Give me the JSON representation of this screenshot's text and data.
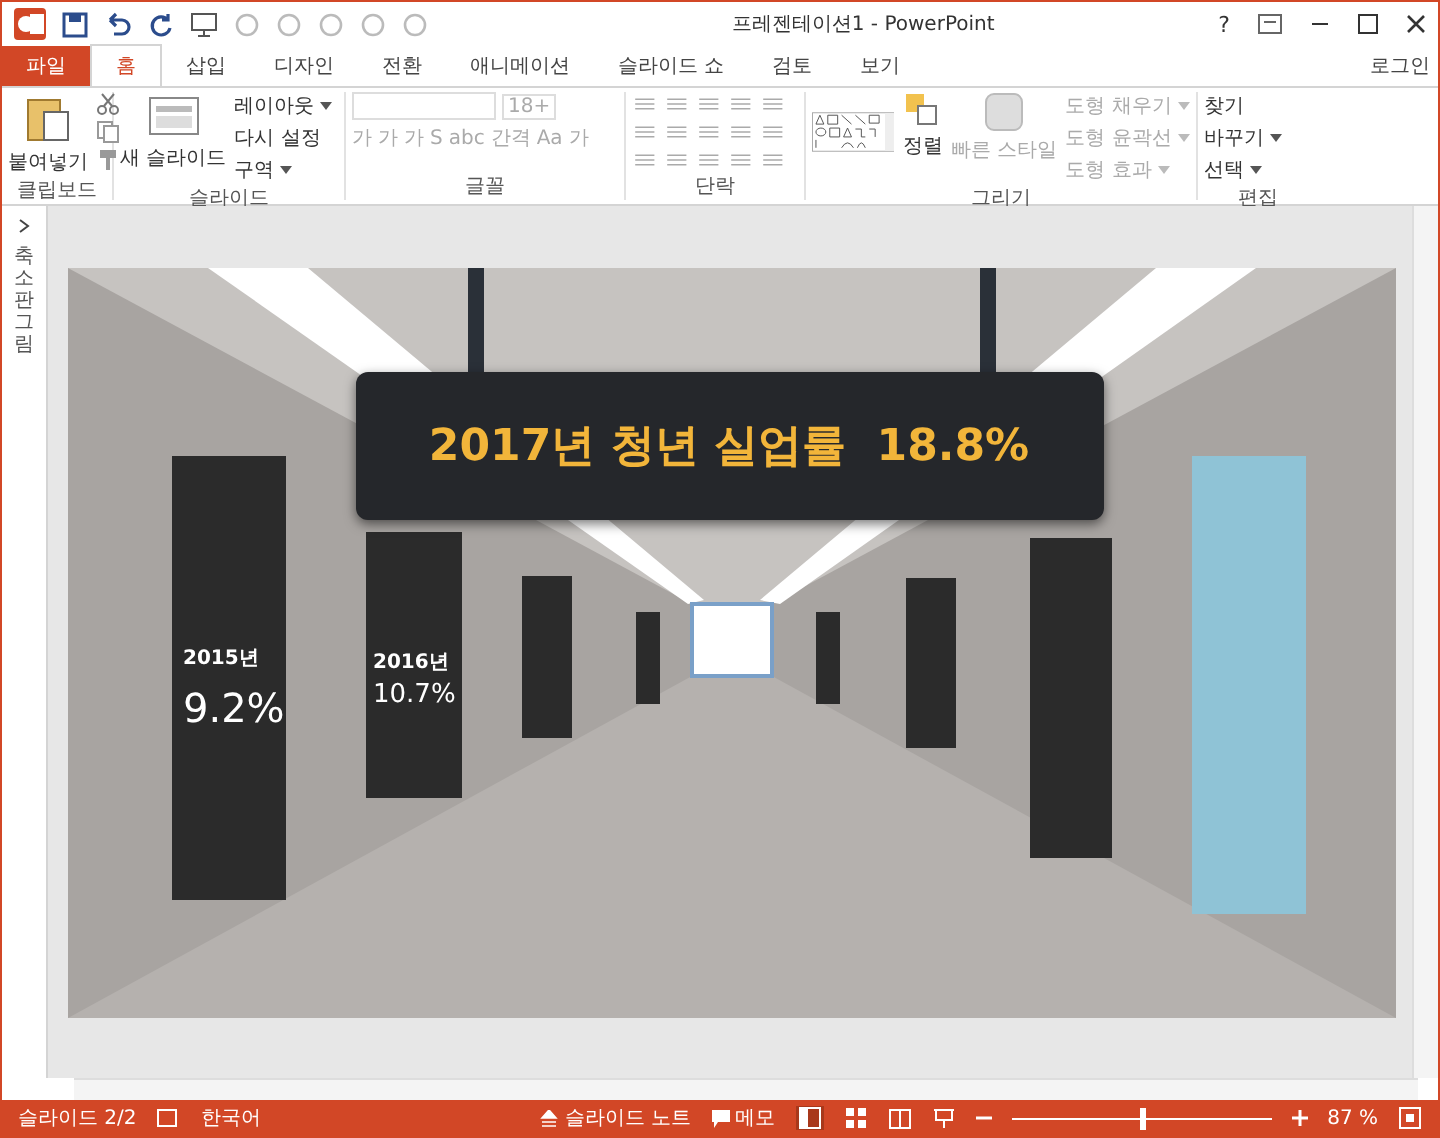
{
  "window": {
    "title": "프레젠테이션1 - PowerPoint",
    "help": "?",
    "account": "로그인"
  },
  "tabs": [
    {
      "label": "파일",
      "kind": "file",
      "selected": false
    },
    {
      "label": "홈",
      "kind": "tab",
      "selected": true
    },
    {
      "label": "삽입",
      "kind": "tab",
      "selected": false
    },
    {
      "label": "디자인",
      "kind": "tab",
      "selected": false
    },
    {
      "label": "전환",
      "kind": "tab",
      "selected": false
    },
    {
      "label": "애니메이션",
      "kind": "tab",
      "selected": false
    },
    {
      "label": "슬라이드 쇼",
      "kind": "tab",
      "selected": false
    },
    {
      "label": "검토",
      "kind": "tab",
      "selected": false
    },
    {
      "label": "보기",
      "kind": "tab",
      "selected": false
    }
  ],
  "ribbon": {
    "clipboard": {
      "label": "클립보드",
      "paste": "붙여넣기"
    },
    "slides": {
      "label": "슬라이드",
      "new_slide": "새 슬라이드",
      "layout": "레이아웃",
      "reset": "다시 설정",
      "section": "구역"
    },
    "font": {
      "label": "글꼴",
      "size": "18+",
      "buttons": [
        "가",
        "가",
        "가",
        "S",
        "abc",
        "간격",
        "Aa",
        "가"
      ]
    },
    "paragraph": {
      "label": "단락"
    },
    "drawing": {
      "label": "그리기",
      "arrange": "정렬",
      "quick_styles": "빠른 스타일",
      "fill": "도형 채우기",
      "outline": "도형 윤곽선",
      "effects": "도형 효과"
    },
    "editing": {
      "label": "편집",
      "find": "찾기",
      "replace": "바꾸기",
      "select": "선택"
    }
  },
  "thumbnail_pane": {
    "label": "축소판 그림"
  },
  "slide": {
    "banner": "2017년 청년 실업률  18.8%",
    "labels": [
      {
        "year": "2015년",
        "value": "9.2%"
      },
      {
        "year": "2016년",
        "value": "10.7%"
      }
    ]
  },
  "status_bar": {
    "slide": "슬라이드 2/2",
    "language": "한국어",
    "notes": "슬라이드 노트",
    "comments": "메모",
    "zoom": "87 %",
    "zoom_slider": {
      "level": 0.5
    }
  }
}
